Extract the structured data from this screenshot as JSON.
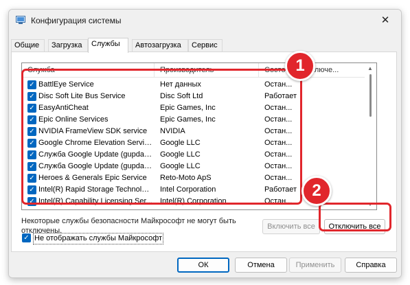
{
  "window": {
    "title": "Конфигурация системы",
    "close_glyph": "✕"
  },
  "tabs": [
    {
      "label": "Общие",
      "active": false
    },
    {
      "label": "Загрузка",
      "active": false
    },
    {
      "label": "Службы",
      "active": true
    },
    {
      "label": "Автозагрузка",
      "active": false
    },
    {
      "label": "Сервис",
      "active": false
    }
  ],
  "services": {
    "columns": [
      "Служба",
      "Производитель",
      "Состо...",
      "отключе..."
    ],
    "rows": [
      {
        "checked": true,
        "name": "BattlEye Service",
        "vendor": "Нет данных",
        "status": "Остан..."
      },
      {
        "checked": true,
        "name": "Disc Soft Lite Bus Service",
        "vendor": "Disc Soft Ltd",
        "status": "Работает"
      },
      {
        "checked": true,
        "name": "EasyAntiCheat",
        "vendor": "Epic Games, Inc",
        "status": "Остан..."
      },
      {
        "checked": true,
        "name": "Epic Online Services",
        "vendor": "Epic Games, Inc",
        "status": "Остан..."
      },
      {
        "checked": true,
        "name": "NVIDIA FrameView SDK service",
        "vendor": "NVIDIA",
        "status": "Остан..."
      },
      {
        "checked": true,
        "name": "Google Chrome Elevation Servic...",
        "vendor": "Google LLC",
        "status": "Остан..."
      },
      {
        "checked": true,
        "name": "Служба Google Update (gupdate)",
        "vendor": "Google LLC",
        "status": "Остан..."
      },
      {
        "checked": true,
        "name": "Служба Google Update (gupdat...",
        "vendor": "Google LLC",
        "status": "Остан..."
      },
      {
        "checked": true,
        "name": "Heroes & Generals Epic Service",
        "vendor": "Reto-Moto ApS",
        "status": "Остан..."
      },
      {
        "checked": true,
        "name": "Intel(R) Rapid Storage Technology",
        "vendor": "Intel Corporation",
        "status": "Работает"
      },
      {
        "checked": true,
        "name": "Intel(R) Capability Licensing Ser...",
        "vendor": "Intel(R) Corporation",
        "status": "Остан..."
      }
    ]
  },
  "note": "Некоторые службы безопасности Майкрософт не могут быть отключены.",
  "buttons": {
    "enable_all": "Включить все",
    "disable_all": "Отключить все",
    "ok": "ОК",
    "cancel": "Отмена",
    "apply": "Применить",
    "help": "Справка"
  },
  "hide_microsoft": {
    "checked": true,
    "label": "Не отображать службы Майкрософт"
  },
  "callouts": [
    {
      "number": "1"
    },
    {
      "number": "2"
    }
  ],
  "colors": {
    "accent": "#0067c0",
    "callout": "#e1262c"
  }
}
